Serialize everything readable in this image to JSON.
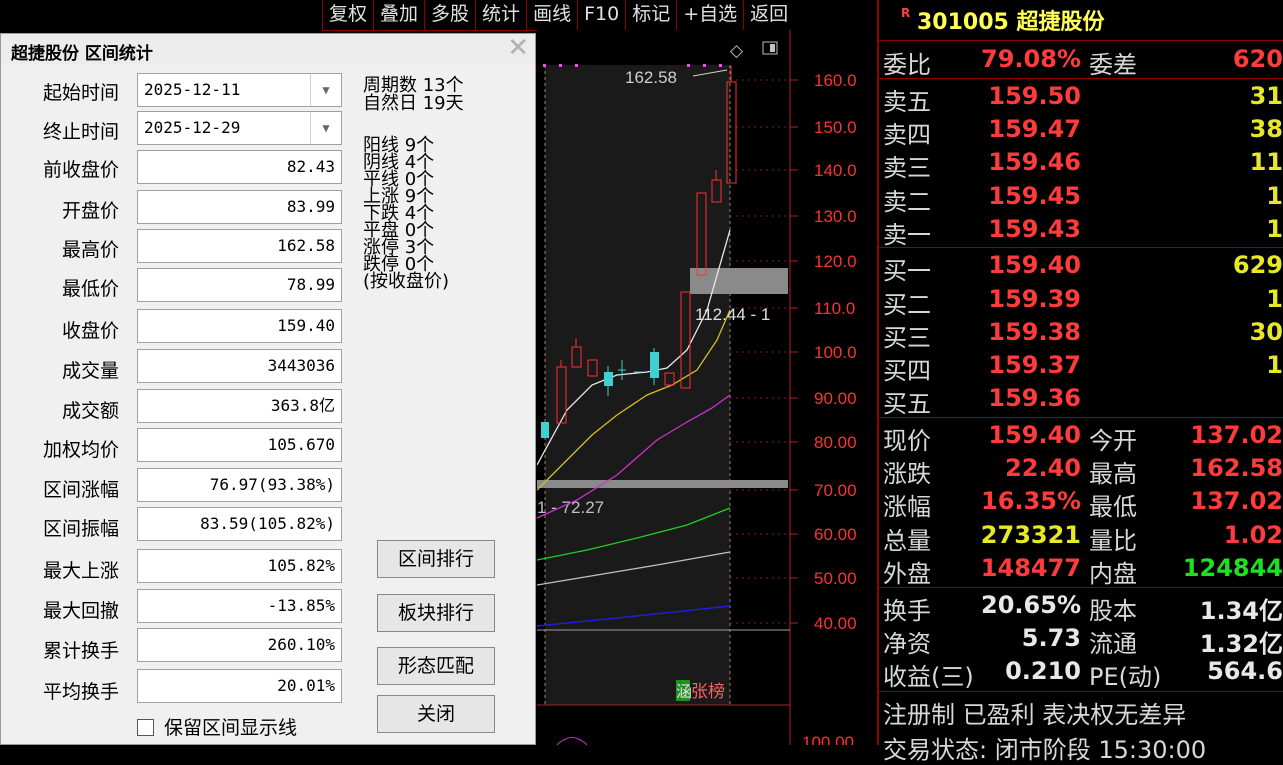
{
  "toolbar": [
    "复权",
    "叠加",
    "多股",
    "统计",
    "画线",
    "F10",
    "标记",
    "+自选",
    "返回"
  ],
  "chart": {
    "peak_label": "162.58",
    "band_label_upper": "112.44 - 1",
    "band_label_lower": "1 - 72.27",
    "badge_left": "涵",
    "badge_right": "张榜",
    "price_axis": [
      "160.0",
      "150.0",
      "140.0",
      "130.0",
      "120.0",
      "110.0",
      "100.0",
      "90.00",
      "80.00",
      "70.00",
      "60.00",
      "50.00",
      "40.00",
      "100.00"
    ]
  },
  "quote": {
    "r_mark": "R",
    "title": "301005 超捷股份",
    "weibi": {
      "label": "委比",
      "value": "79.08%",
      "label2": "委差",
      "value2": "620"
    },
    "asks": [
      {
        "label": "卖五",
        "price": "159.50",
        "vol": "31"
      },
      {
        "label": "卖四",
        "price": "159.47",
        "vol": "38"
      },
      {
        "label": "卖三",
        "price": "159.46",
        "vol": "11"
      },
      {
        "label": "卖二",
        "price": "159.45",
        "vol": "1"
      },
      {
        "label": "卖一",
        "price": "159.43",
        "vol": "1"
      }
    ],
    "bids": [
      {
        "label": "买一",
        "price": "159.40",
        "vol": "629"
      },
      {
        "label": "买二",
        "price": "159.39",
        "vol": "1"
      },
      {
        "label": "买三",
        "price": "159.38",
        "vol": "30"
      },
      {
        "label": "买四",
        "price": "159.37",
        "vol": "1"
      },
      {
        "label": "买五",
        "price": "159.36",
        "vol": ""
      }
    ],
    "stats": [
      {
        "l1": "现价",
        "v1": "159.40",
        "c1": "red",
        "l2": "今开",
        "v2": "137.02",
        "c2": "red"
      },
      {
        "l1": "涨跌",
        "v1": "22.40",
        "c1": "red",
        "l2": "最高",
        "v2": "162.58",
        "c2": "red"
      },
      {
        "l1": "涨幅",
        "v1": "16.35%",
        "c1": "red",
        "l2": "最低",
        "v2": "137.02",
        "c2": "red"
      },
      {
        "l1": "总量",
        "v1": "273321",
        "c1": "yel",
        "l2": "量比",
        "v2": "1.02",
        "c2": "red"
      },
      {
        "l1": "外盘",
        "v1": "148477",
        "c1": "red",
        "l2": "内盘",
        "v2": "124844",
        "c2": "grn"
      }
    ],
    "stats2": [
      {
        "l1": "换手",
        "v1": "20.65%",
        "l2": "股本",
        "v2": "1.34亿"
      },
      {
        "l1": "净资",
        "v1": "5.73",
        "l2": "流通",
        "v2": "1.32亿"
      },
      {
        "l1": "收益(三)",
        "v1": "0.210",
        "l2": "PE(动)",
        "v2": "564.6"
      }
    ],
    "note": "注册制 已盈利 表决权无差异",
    "status": "交易状态: 闭市阶段 15:30:00"
  },
  "dialog": {
    "title": "超捷股份 区间统计",
    "start_label": "起始时间",
    "start_value": "2025-12-11",
    "end_label": "终止时间",
    "end_value": "2025-12-29",
    "fields": [
      {
        "label": "前收盘价",
        "value": "82.43"
      },
      {
        "label": "开盘价",
        "value": "83.99"
      },
      {
        "label": "最高价",
        "value": "162.58"
      },
      {
        "label": "最低价",
        "value": "78.99"
      },
      {
        "label": "收盘价",
        "value": "159.40"
      },
      {
        "label": "成交量",
        "value": "3443036"
      },
      {
        "label": "成交额",
        "value": "363.8亿"
      },
      {
        "label": "加权均价",
        "value": "105.670"
      },
      {
        "label": "区间涨幅",
        "value": "76.97(93.38%)"
      },
      {
        "label": "区间振幅",
        "value": "83.59(105.82%)"
      },
      {
        "label": "最大上涨",
        "value": "105.82%"
      },
      {
        "label": "最大回撤",
        "value": "-13.85%"
      },
      {
        "label": "累计换手",
        "value": "260.10%"
      },
      {
        "label": "平均换手",
        "value": "20.01%"
      }
    ],
    "period_stats": [
      "周期数 13个",
      "自然日 19天"
    ],
    "candle_stats": [
      "阳线 9个",
      "阴线 4个",
      "平线 0个",
      "上涨 9个",
      "下跌 4个",
      "平盘 0个",
      "涨停 3个",
      "跌停 0个",
      "(按收盘价)"
    ],
    "buttons": {
      "rank": "区间排行",
      "sector_rank": "板块排行",
      "pattern": "形态匹配",
      "close": "关闭"
    },
    "keep_checkbox": "保留区间显示线"
  }
}
